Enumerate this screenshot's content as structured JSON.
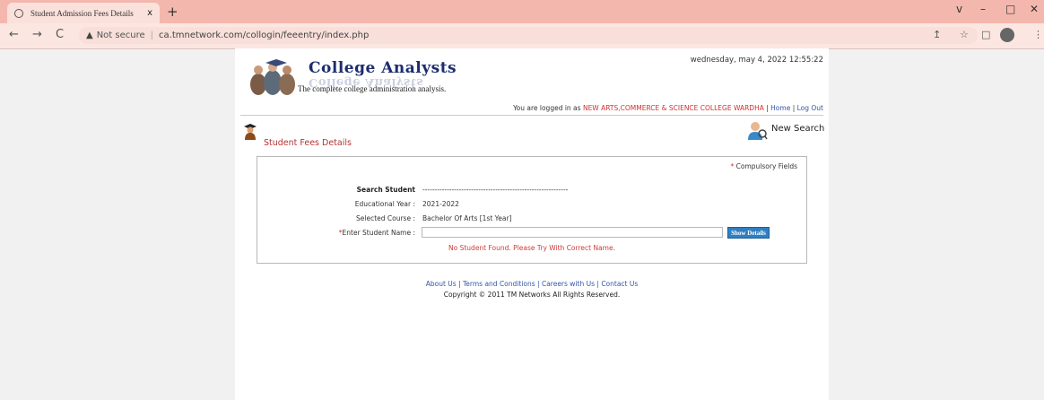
{
  "browser": {
    "tab_title": "Student Admission Fees Details",
    "tab_close": "x",
    "new_tab": "+",
    "window_controls": [
      "v",
      "–",
      "□",
      "✕"
    ],
    "nav_buttons": [
      "←",
      "→",
      "C"
    ],
    "warning_icon": "▲",
    "not_secure": "Not secure",
    "url": "ca.tmnetwork.com/collogin/feeentry/index.php",
    "right_icons": [
      "↥",
      "☆",
      "□",
      "⋮"
    ]
  },
  "header": {
    "brand": "College Analysts",
    "tagline": "The complete college administration analysis.",
    "datetime": "wednesday, may 4, 2022 12:55:22",
    "logged_in_prefix": "You are logged in as ",
    "college": "NEW ARTS,COMMERCE & SCIENCE COLLEGE WARDHA",
    "sep1": " | ",
    "home": "Home",
    "sep2": " | ",
    "logout": "Log Out"
  },
  "section": {
    "title": "Student Fees Details",
    "new_search": "New Search"
  },
  "form": {
    "star": "*",
    "compulsory": "Compulsory Fields",
    "search_label": "Search Student",
    "search_dashes": "------------------------------------------------------------",
    "edu_year_label": "Educational Year :",
    "edu_year_value": "2021-2022",
    "course_label": "Selected Course :",
    "course_value": "Bachelor Of Arts [1st Year]",
    "name_label": "Enter Student Name :",
    "name_value": "",
    "show_button": "Show Details",
    "error": "No Student Found. Please Try With Correct Name."
  },
  "footer": {
    "about": "About Us",
    "terms": "Terms and Conditions",
    "careers": "Careers with Us",
    "contact": "Contact Us",
    "sep": " | ",
    "copyright": "Copyright © 2011 TM Networks All Rights Reserved."
  },
  "colors": {
    "tabbar": "#f4b7ad",
    "accent_red": "#d03030",
    "link_blue": "#3355aa",
    "button_blue": "#2f7fc1"
  }
}
